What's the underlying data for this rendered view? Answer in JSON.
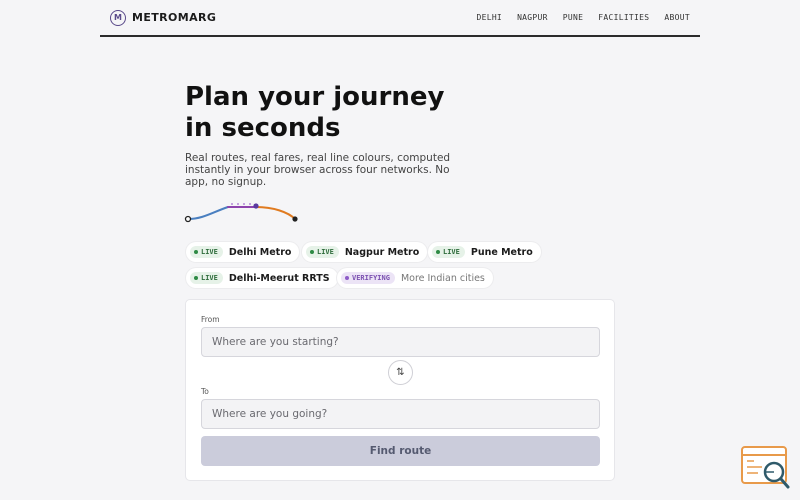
{
  "brand": {
    "logo_letter": "M",
    "name": "METROMARG"
  },
  "nav": [
    "DELHI",
    "NAGPUR",
    "PUNE",
    "FACILITIES",
    "ABOUT"
  ],
  "hero": {
    "title_line1": "Plan your journey",
    "title_line2": "in seconds",
    "subtitle": "Real routes, real fares, real line colours, computed instantly in your browser across four networks. No app, no signup."
  },
  "networks": [
    {
      "status": "LIVE",
      "name": "Delhi Metro"
    },
    {
      "status": "LIVE",
      "name": "Nagpur Metro"
    },
    {
      "status": "LIVE",
      "name": "Pune Metro"
    },
    {
      "status": "LIVE",
      "name": "Delhi-Meerut RRTS"
    },
    {
      "status": "VERIFYING",
      "name": "More Indian cities"
    }
  ],
  "form": {
    "from_label": "From",
    "from_placeholder": "Where are you starting?",
    "to_label": "To",
    "to_placeholder": "Where are you going?",
    "swap_icon": "⇅",
    "submit_label": "Find route"
  },
  "colors": {
    "accent": "#5a4a8a",
    "live_badge": "#2e8b44",
    "verifying_badge": "#8e5cc8",
    "button_disabled": "#cbccdb",
    "route_blue": "#4a7fc0",
    "route_purple": "#8e44ad",
    "route_orange": "#e07b20"
  },
  "icons": {
    "logo": "metro-logo-icon",
    "swap": "swap-arrows-icon",
    "corner": "search-window-icon"
  }
}
